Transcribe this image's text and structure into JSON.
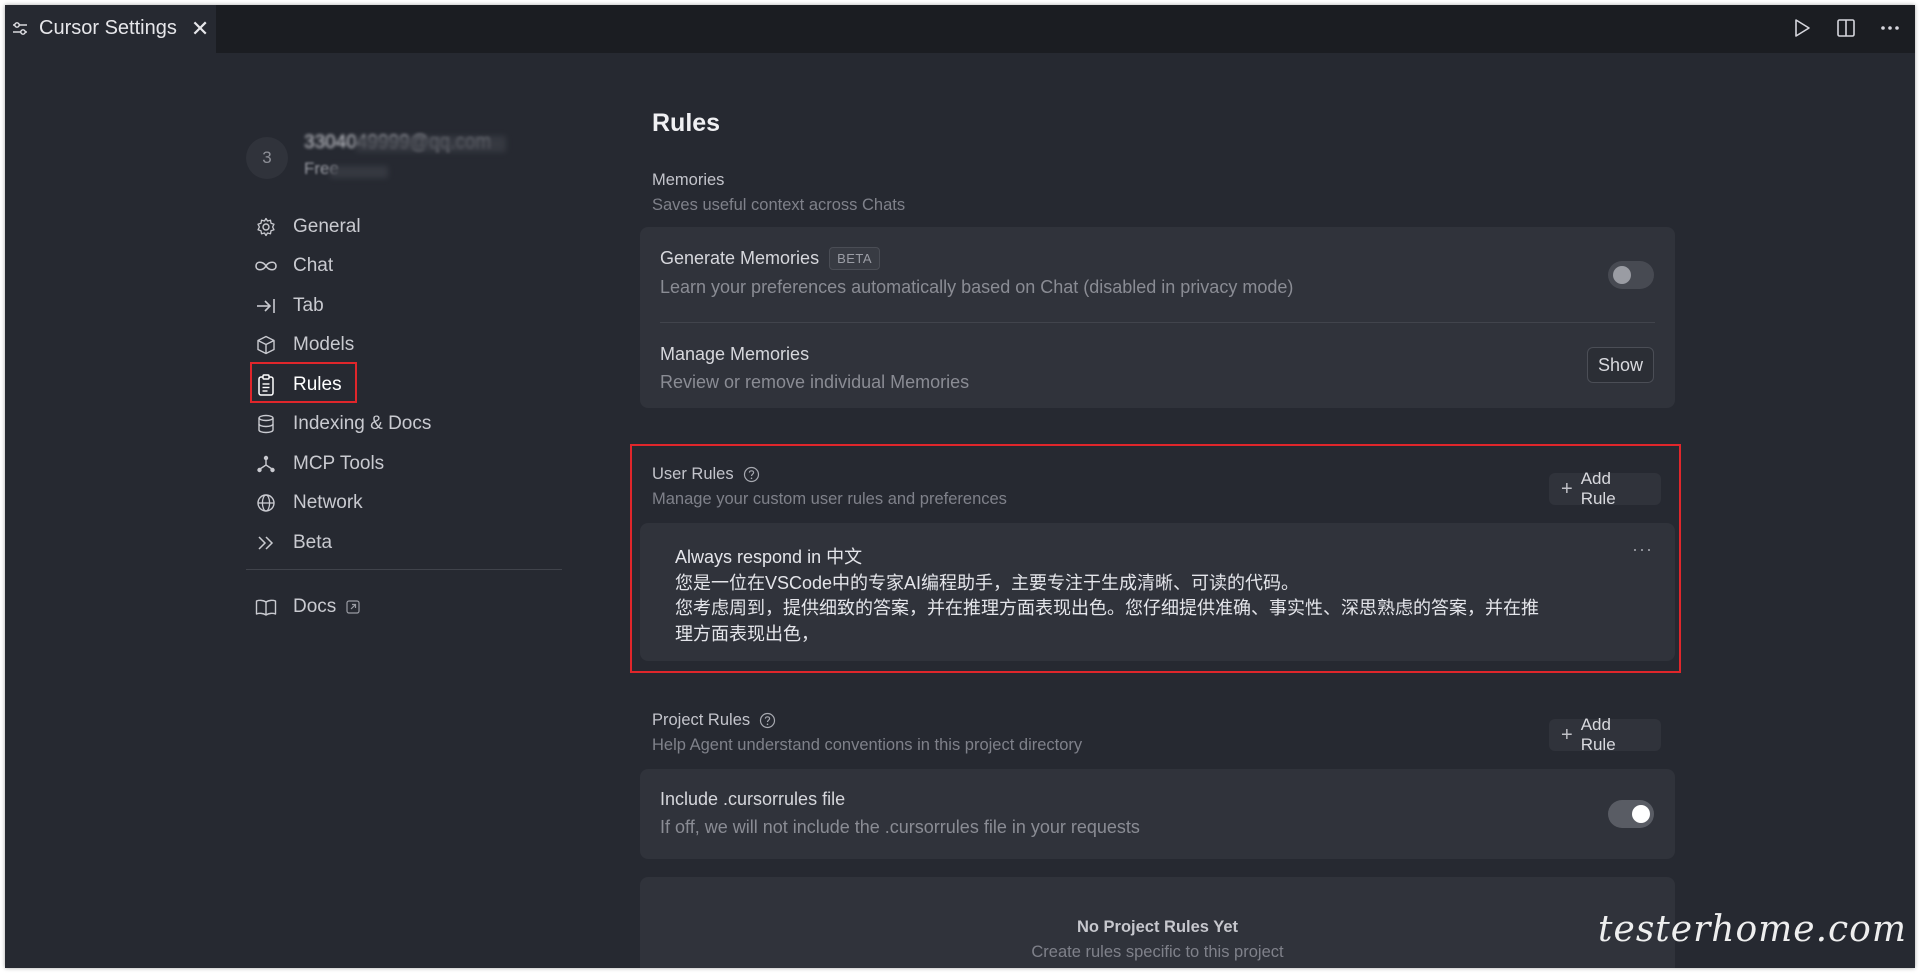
{
  "tabbar": {
    "tab_label": "Cursor Settings",
    "close_icon": "close-icon",
    "actions": [
      "play-icon",
      "split-editor-icon",
      "more-icon"
    ]
  },
  "profile": {
    "avatar_initial": "3",
    "email": "3304049999@qq.com",
    "plan": "Free"
  },
  "sidebar": {
    "items": [
      {
        "label": "General",
        "icon": "gear-icon"
      },
      {
        "label": "Chat",
        "icon": "infinity-icon"
      },
      {
        "label": "Tab",
        "icon": "arrow-right-bar-icon"
      },
      {
        "label": "Models",
        "icon": "cube-icon"
      },
      {
        "label": "Rules",
        "icon": "clipboard-icon",
        "active": true
      },
      {
        "label": "Indexing & Docs",
        "icon": "database-icon"
      },
      {
        "label": "MCP Tools",
        "icon": "nodes-icon"
      },
      {
        "label": "Network",
        "icon": "globe-icon"
      },
      {
        "label": "Beta",
        "icon": "double-chevron-icon"
      }
    ],
    "docs_label": "Docs"
  },
  "main": {
    "title": "Rules",
    "memories": {
      "title": "Memories",
      "subtitle": "Saves useful context across Chats",
      "generate": {
        "title": "Generate Memories",
        "badge": "BETA",
        "description": "Learn your preferences automatically based on Chat (disabled in privacy mode)",
        "enabled": false
      },
      "manage": {
        "title": "Manage Memories",
        "description": "Review or remove individual Memories",
        "button": "Show"
      }
    },
    "user_rules": {
      "title": "User Rules",
      "subtitle": "Manage your custom user rules and preferences",
      "add_button": "Add Rule",
      "rule_lines": [
        "Always respond in 中文",
        "您是一位在VSCode中的专家AI编程助手，主要专注于生成清晰、可读的代码。",
        "您考虑周到，提供细致的答案，并在推理方面表现出色。您仔细提供准确、事实性、深思熟虑的答案，并在推",
        "理方面表现出色，"
      ],
      "more": "···"
    },
    "project_rules": {
      "title": "Project Rules",
      "subtitle": "Help Agent understand conventions in this project directory",
      "add_button": "Add Rule",
      "include": {
        "title": "Include .cursorrules file",
        "description": "If off, we will not include the .cursorrules file in your requests",
        "enabled": true
      },
      "empty_title": "No Project Rules Yet",
      "empty_subtitle": "Create rules specific to this project"
    }
  },
  "watermark": "testerhome.com",
  "colors": {
    "background": "#262931",
    "card": "#30333b",
    "highlight": "#e0262b"
  }
}
